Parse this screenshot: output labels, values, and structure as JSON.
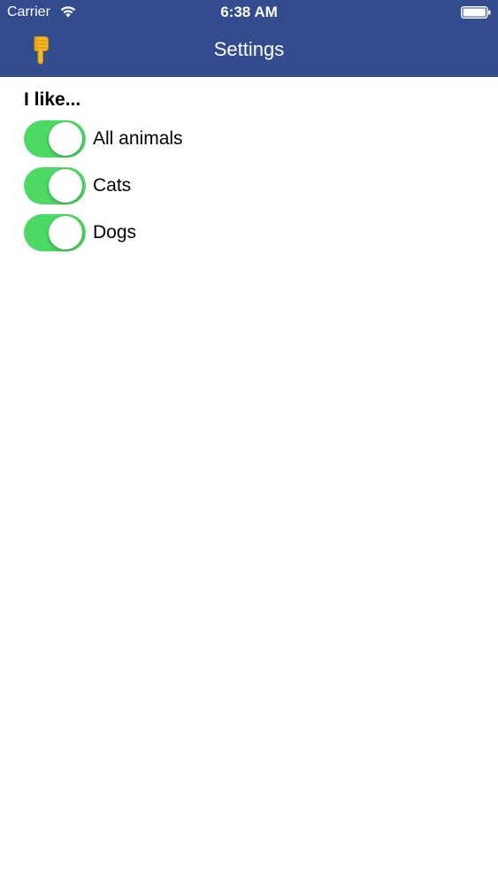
{
  "status_bar": {
    "carrier": "Carrier",
    "time": "6:38 AM",
    "wifi_icon": "wifi-icon",
    "battery_icon": "battery-full-icon"
  },
  "nav_bar": {
    "title": "Settings",
    "left_icon": "pointing-hand-icon",
    "background_color": "#324c8e"
  },
  "preferences": {
    "heading": "I like...",
    "accent_color": "#4cd964",
    "items": [
      {
        "label": "All animals",
        "on": true
      },
      {
        "label": "Cats",
        "on": true
      },
      {
        "label": "Dogs",
        "on": true
      }
    ]
  }
}
